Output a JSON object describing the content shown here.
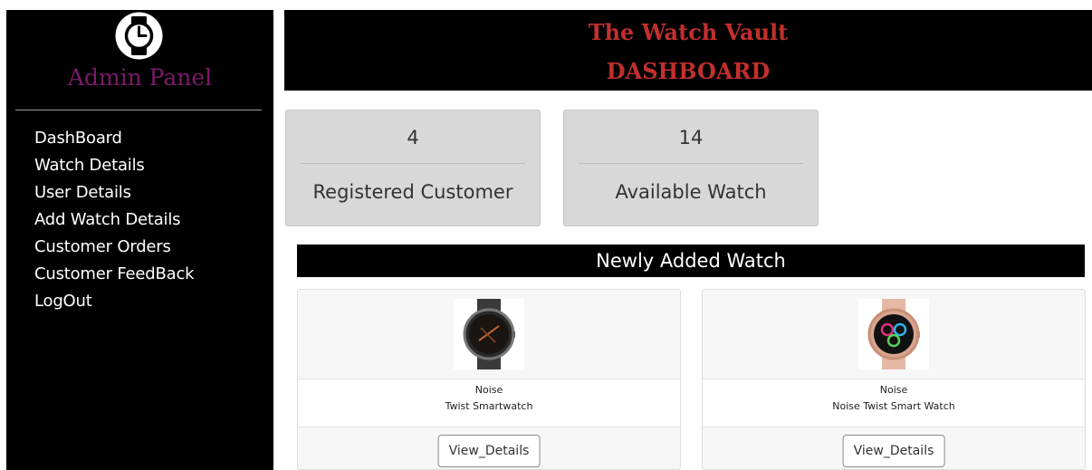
{
  "sidebar": {
    "title": "Admin Panel",
    "nav": [
      {
        "label": "DashBoard"
      },
      {
        "label": "Watch Details"
      },
      {
        "label": "User Details"
      },
      {
        "label": "Add Watch Details"
      },
      {
        "label": "Customer Orders"
      },
      {
        "label": "Customer FeedBack"
      },
      {
        "label": "LogOut"
      }
    ]
  },
  "header": {
    "site_title": "The Watch Vault",
    "page_title": "DASHBOARD"
  },
  "stats": [
    {
      "value": "4",
      "label": "Registered Customer"
    },
    {
      "value": "14",
      "label": "Available Watch"
    }
  ],
  "newly_added": {
    "heading": "Newly Added Watch",
    "products": [
      {
        "brand": "Noise",
        "name": "Twist Smartwatch",
        "button": "View_Details",
        "strap_color": "#3a3a3a"
      },
      {
        "brand": "Noise",
        "name": "Noise Twist Smart Watch",
        "button": "View_Details",
        "strap_color": "#e6b9a6"
      }
    ]
  },
  "colors": {
    "sidebar_bg": "#000000",
    "admin_title": "#7a1a6a",
    "header_title": "#c0302d",
    "card_bg": "#d8d8d8"
  },
  "icons": {
    "logo": "clock-icon"
  }
}
